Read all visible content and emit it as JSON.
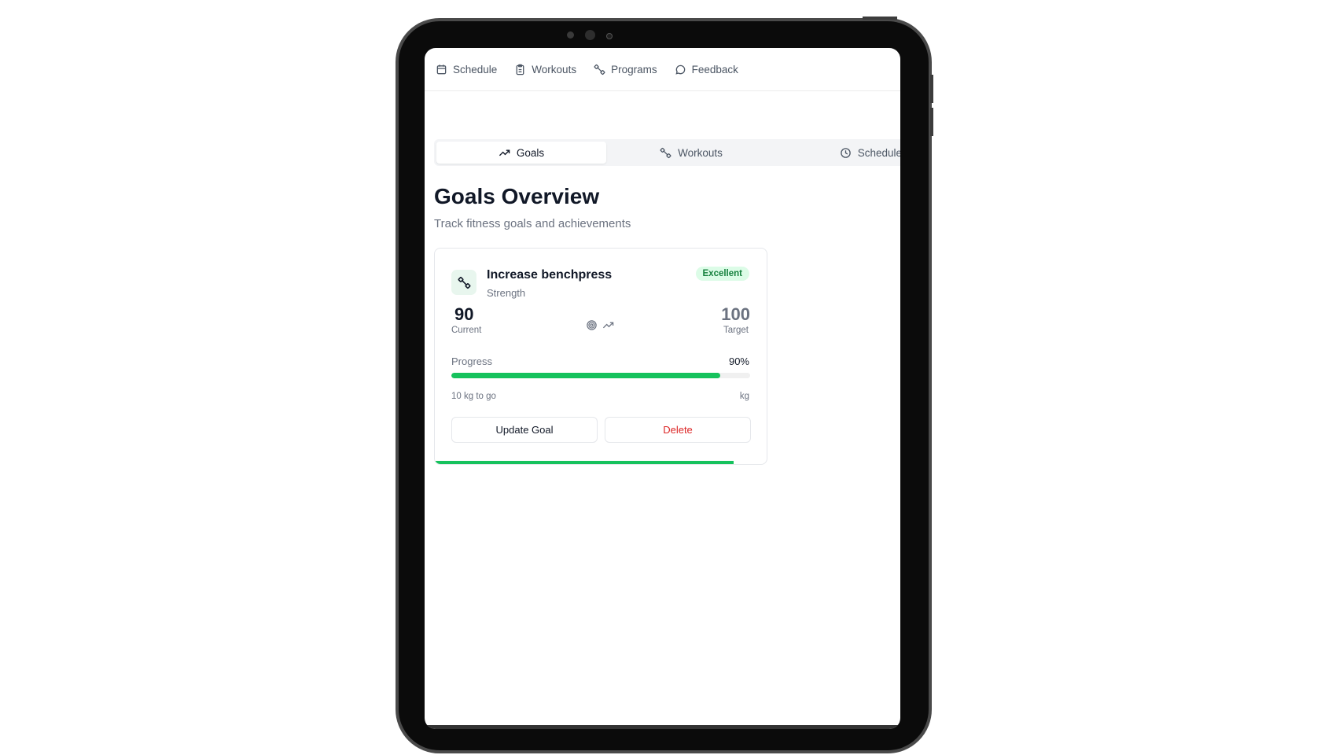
{
  "nav": {
    "items": [
      {
        "label": "Schedule",
        "icon": "calendar-icon"
      },
      {
        "label": "Workouts",
        "icon": "clipboard-icon"
      },
      {
        "label": "Programs",
        "icon": "dumbbell-icon"
      },
      {
        "label": "Feedback",
        "icon": "chat-bubble-icon"
      }
    ]
  },
  "tabs": [
    {
      "label": "Goals",
      "icon": "trending-up-icon",
      "active": true
    },
    {
      "label": "Workouts",
      "icon": "dumbbell-icon",
      "active": false
    },
    {
      "label": "Schedule",
      "icon": "clock-icon",
      "active": false
    }
  ],
  "page": {
    "title": "Goals Overview",
    "subtitle": "Track fitness goals and achievements"
  },
  "goal": {
    "name": "Increase benchpress",
    "category": "Strength",
    "status": "Excellent",
    "current": "90",
    "current_label": "Current",
    "target": "100",
    "target_label": "Target",
    "progress_label": "Progress",
    "progress_text": "90%",
    "progress_fraction": 0.9,
    "remaining": "10 kg to go",
    "unit": "kg",
    "update_label": "Update Goal",
    "delete_label": "Delete"
  },
  "colors": {
    "accent": "#16c25d",
    "badge_bg": "#dcfce7",
    "badge_text": "#15803d",
    "danger": "#dc2626"
  }
}
